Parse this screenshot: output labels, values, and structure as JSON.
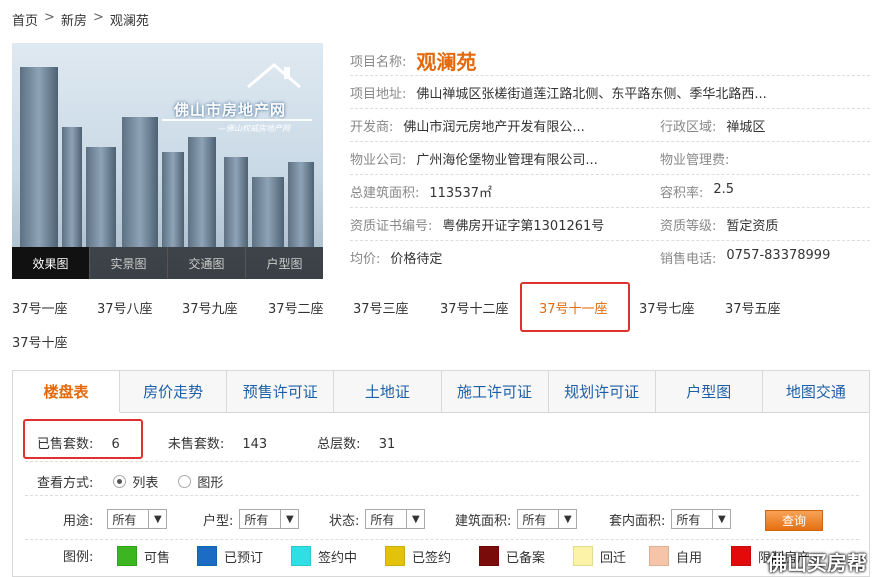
{
  "breadcrumb": {
    "home": "首页",
    "sep": ">",
    "newhouse": "新房",
    "current": "观澜苑"
  },
  "photo": {
    "logo": "佛山市房地产网",
    "logo_sub": "—佛山权威房地产网",
    "tabs": [
      "效果图",
      "实景图",
      "交通图",
      "户型图"
    ]
  },
  "info": {
    "name_label": "项目名称:",
    "name": "观澜苑",
    "addr_label": "项目地址:",
    "addr": "佛山禅城区张槎街道莲江路北侧、东平路东侧、季华北路西...",
    "dev_label": "开发商:",
    "dev": "佛山市润元房地产开发有限公...",
    "district_label": "行政区域:",
    "district": "禅城区",
    "pm_label": "物业公司:",
    "pm": "广州海伦堡物业管理有限公司...",
    "pmfee_label": "物业管理费:",
    "pmfee": "",
    "area_label": "总建筑面积:",
    "area": "113537㎡",
    "far_label": "容积率:",
    "far": "2.5",
    "cert_label": "资质证书编号:",
    "cert": "粤佛房开证字第1301261号",
    "grade_label": "资质等级:",
    "grade": "暂定资质",
    "price_label": "均价:",
    "price": "价格待定",
    "tel_label": "销售电话:",
    "tel": "0757-83378999"
  },
  "buildings": [
    "37号一座",
    "37号八座",
    "37号九座",
    "37号二座",
    "37号三座",
    "37号十二座",
    "37号十一座",
    "37号七座",
    "37号五座",
    "37号十座"
  ],
  "tabs": [
    "楼盘表",
    "房价走势",
    "预售许可证",
    "土地证",
    "施工许可证",
    "规划许可证",
    "户型图",
    "地图交通"
  ],
  "stats": {
    "sold_label": "已售套数:",
    "sold": "6",
    "unsold_label": "未售套数:",
    "unsold": "143",
    "floors_label": "总层数:",
    "floors": "31"
  },
  "view": {
    "label": "查看方式:",
    "list": "列表",
    "graph": "图形"
  },
  "filters": {
    "use_label": "用途:",
    "use": "所有",
    "type_label": "户型:",
    "type": "所有",
    "status_label": "状态:",
    "status": "所有",
    "area_label": "建筑面积:",
    "area": "所有",
    "inner_label": "套内面积:",
    "inner": "所有",
    "query": "查询"
  },
  "legend": {
    "label": "图例:",
    "items": [
      {
        "name": "可售",
        "color": "#3cb521"
      },
      {
        "name": "已预订",
        "color": "#1b6cc2"
      },
      {
        "name": "签约中",
        "color": "#2ee0e6"
      },
      {
        "name": "已签约",
        "color": "#e3c20d"
      },
      {
        "name": "已备案",
        "color": "#7a0b0b"
      },
      {
        "name": "回迁",
        "color": "#fdf3a8"
      },
      {
        "name": "自用",
        "color": "#f6c4a8"
      },
      {
        "name": "限制房产",
        "color": "#e20a0a"
      }
    ]
  },
  "watermark": "佛山买房帮",
  "colors": {
    "accent": "#e4690b",
    "link": "#1d5fa7",
    "highlight_box": "#e03131"
  }
}
